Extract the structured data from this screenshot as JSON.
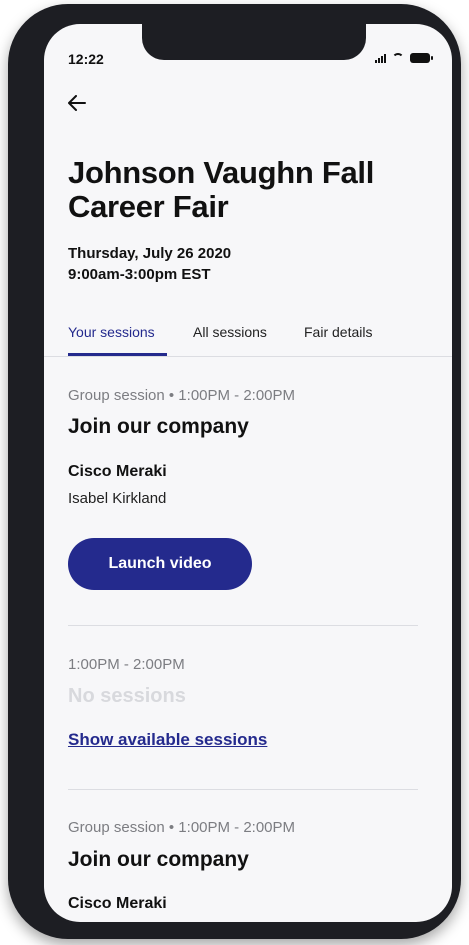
{
  "status_bar": {
    "time": "12:22"
  },
  "header": {
    "back_icon": "arrow-left-icon",
    "title": "Johnson Vaughn Fall Career Fair",
    "date": "Thursday, July 26 2020",
    "time_range": "9:00am-3:00pm EST"
  },
  "tabs": [
    {
      "label": "Your sessions",
      "active": true
    },
    {
      "label": "All sessions",
      "active": false
    },
    {
      "label": "Fair details",
      "active": false
    }
  ],
  "sessions": [
    {
      "meta": "Group session • 1:00PM - 2:00PM",
      "title": "Join our company",
      "company": "Cisco Meraki",
      "person": "Isabel Kirkland",
      "button_label": "Launch video"
    },
    {
      "meta": "1:00PM - 2:00PM",
      "empty_label": "No sessions",
      "link_label": "Show available sessions"
    },
    {
      "meta": "Group session • 1:00PM - 2:00PM",
      "title": "Join our company",
      "company": "Cisco Meraki"
    }
  ],
  "colors": {
    "accent": "#242a8d",
    "muted_text": "#7c7d82",
    "disabled_text": "#d8d9dd",
    "frame": "#1d1e23"
  }
}
